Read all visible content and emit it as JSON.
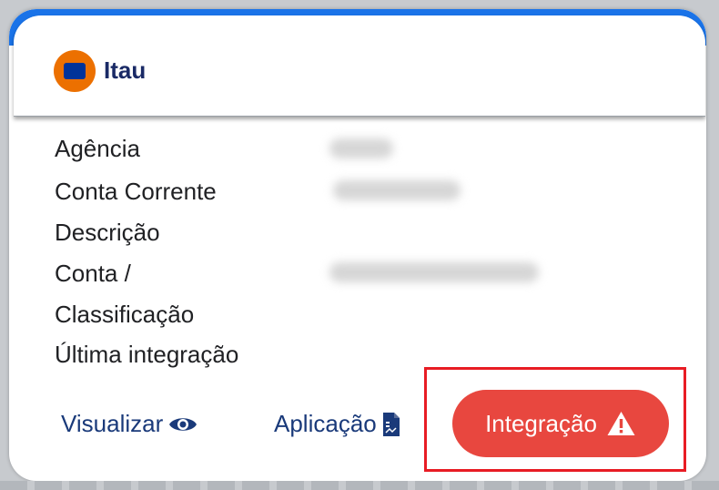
{
  "bank": {
    "name": "Itau",
    "logo_text": "Itaú"
  },
  "fields": {
    "agencia_label": "Agência",
    "conta_corrente_label": "Conta Corrente",
    "descricao_label": "Descrição",
    "conta_label_line1": "Conta /",
    "conta_label_line2": "Classificação",
    "ultima_integracao_label": "Última integração"
  },
  "actions": {
    "visualizar_label": "Visualizar",
    "aplicacao_label": "Aplicação",
    "integracao_label": "Integração"
  },
  "colors": {
    "accent_blue": "#1a73e8",
    "integracao_red": "#e8473f",
    "highlight_red": "#e81c24",
    "link_text": "#1a3a7a"
  },
  "icons": {
    "visualizar": "eye-icon",
    "aplicacao": "document-icon",
    "integracao": "warning-icon"
  }
}
